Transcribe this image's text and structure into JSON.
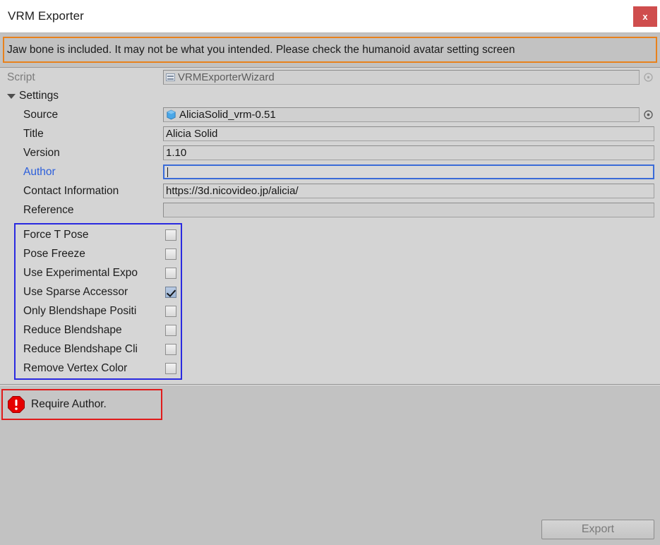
{
  "window": {
    "title": "VRM Exporter",
    "close_label": "x",
    "close_icon": "close-icon"
  },
  "warning": {
    "text": "Jaw bone is included. It may not be what you intended. Please check the humanoid avatar setting screen",
    "border_color": "#e8811c"
  },
  "inspector": {
    "script_row": {
      "label": "Script",
      "value": "VRMExporterWizard",
      "icon": "script-asset-icon",
      "picker_icon": "object-picker-icon"
    },
    "foldout": {
      "label": "Settings",
      "arrow_icon": "triangle-down-icon",
      "expanded": true
    },
    "fields": [
      {
        "label": "Source",
        "value": "AliciaSolid_vrm-0.51",
        "type": "object",
        "icon": "prefab-cube-icon",
        "picker_icon": "object-picker-icon"
      },
      {
        "label": "Title",
        "value": "Alicia Solid",
        "type": "text"
      },
      {
        "label": "Version",
        "value": "1.10",
        "type": "text"
      },
      {
        "label": "Author",
        "value": "",
        "type": "text",
        "focused": true
      },
      {
        "label": "Contact Information",
        "value": "https://3d.nicovideo.jp/alicia/",
        "type": "text"
      },
      {
        "label": "Reference",
        "value": "",
        "type": "text"
      }
    ],
    "checkboxes": [
      {
        "label": "Force T Pose",
        "checked": false
      },
      {
        "label": "Pose Freeze",
        "checked": false
      },
      {
        "label": "Use Experimental Expo",
        "checked": false
      },
      {
        "label": "Use Sparse Accessor",
        "checked": true
      },
      {
        "label": "Only Blendshape Positi",
        "checked": false
      },
      {
        "label": "Reduce Blendshape",
        "checked": false
      },
      {
        "label": "Reduce Blendshape Cli",
        "checked": false
      },
      {
        "label": "Remove Vertex Color",
        "checked": false
      }
    ],
    "checkbox_group_border_color": "#2a2ae0"
  },
  "error": {
    "text": "Require Author.",
    "icon": "error-octagon-icon",
    "border_color": "#e01b1b"
  },
  "footer": {
    "export_label": "Export",
    "export_disabled": true
  }
}
